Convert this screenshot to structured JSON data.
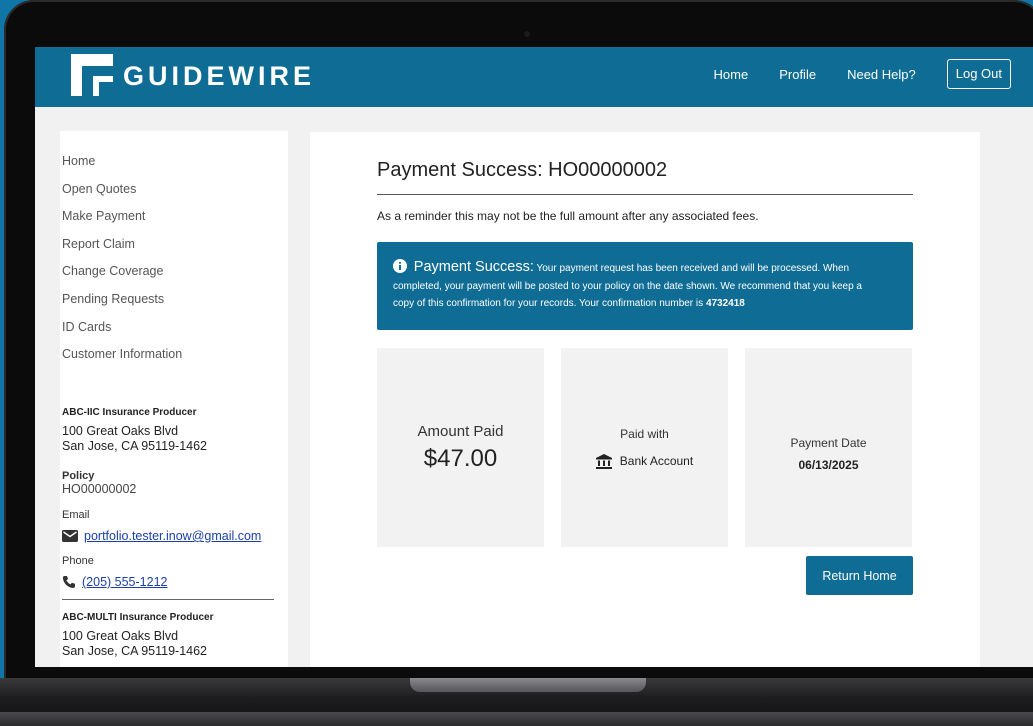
{
  "header": {
    "logo_text": "GUIDEWIRE",
    "nav": [
      "Home",
      "Profile",
      "Need Help?"
    ],
    "logout_label": "Log Out"
  },
  "sidebar": {
    "items": [
      {
        "label": "Home"
      },
      {
        "label": "Open Quotes"
      },
      {
        "label": "Make Payment"
      },
      {
        "label": "Report Claim"
      },
      {
        "label": "Change Coverage"
      },
      {
        "label": "Pending Requests"
      },
      {
        "label": "ID Cards"
      },
      {
        "label": "Customer Information"
      }
    ],
    "producer": {
      "name": "ABC-IIC Insurance Producer",
      "address_line1": "100 Great Oaks Blvd",
      "address_line2": "San Jose, CA 95119-1462",
      "policy_label": "Policy",
      "policy_value": "HO00000002",
      "email_label": "Email",
      "email": "portfolio.tester.inow@gmail.com",
      "phone_label": "Phone",
      "phone": "(205) 555-1212"
    },
    "producer2": {
      "name": "ABC-MULTI Insurance Producer",
      "address_line1": "100 Great Oaks Blvd",
      "address_line2": "San Jose, CA 95119-1462"
    }
  },
  "main": {
    "title": "Payment Success: HO00000002",
    "reminder": "As a reminder this may not be the full amount after any associated fees.",
    "alert": {
      "title": "Payment Success:",
      "line1": "Your payment request has been received and will be processed. When",
      "line2": "completed, your payment will be posted to your policy on the date shown. We recommend that you keep a",
      "line3": "copy of this confirmation for your records. Your confirmation number is",
      "confirmation_number": "4732418"
    },
    "amount_label": "Amount Paid",
    "amount_value": "$47.00",
    "paid_with_label": "Paid with",
    "paid_with_value": "Bank Account",
    "payment_date_label": "Payment Date",
    "payment_date_value": "06/13/2025",
    "return_label": "Return Home"
  },
  "colors": {
    "brand": "#0f6c94",
    "background": "#0f76a7",
    "link": "#1a3faa"
  },
  "icons": [
    "info-icon",
    "bank-icon",
    "mail-icon",
    "phone-icon"
  ]
}
